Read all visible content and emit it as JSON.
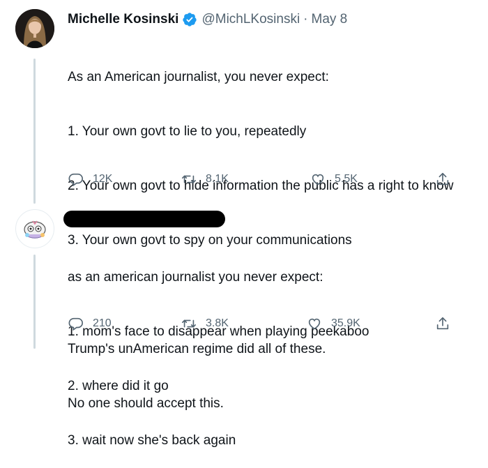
{
  "tweet1": {
    "author_name": "Michelle Kosinski",
    "handle": "@MichLKosinski",
    "separator": "·",
    "date": "May 8",
    "lines": [
      "As an American journalist, you never expect:",
      "1. Your own govt to lie to you, repeatedly",
      "2. Your own govt to hide information the public has a right to know",
      "3. Your own govt to spy on your communications",
      "",
      "Trump's unAmerican regime did all of these.",
      "No one should accept this."
    ],
    "reply_count": "12K",
    "retweet_count": "8.1K",
    "like_count": "5.5K"
  },
  "tweet2": {
    "lines": [
      "as an american journalist you never expect:",
      "1. mom's face to disappear when playing peekaboo",
      "2. where did it go",
      "3. wait now she's back again"
    ],
    "reply_count": "210",
    "retweet_count": "3.8K",
    "like_count": "35.9K"
  },
  "icons": {
    "verified": "verified-badge-icon",
    "reply": "reply-icon",
    "retweet": "retweet-icon",
    "like": "heart-icon",
    "share": "share-icon"
  },
  "colors": {
    "verified": "#1d9bf0",
    "muted": "#536471",
    "thread": "#cfd9de"
  }
}
